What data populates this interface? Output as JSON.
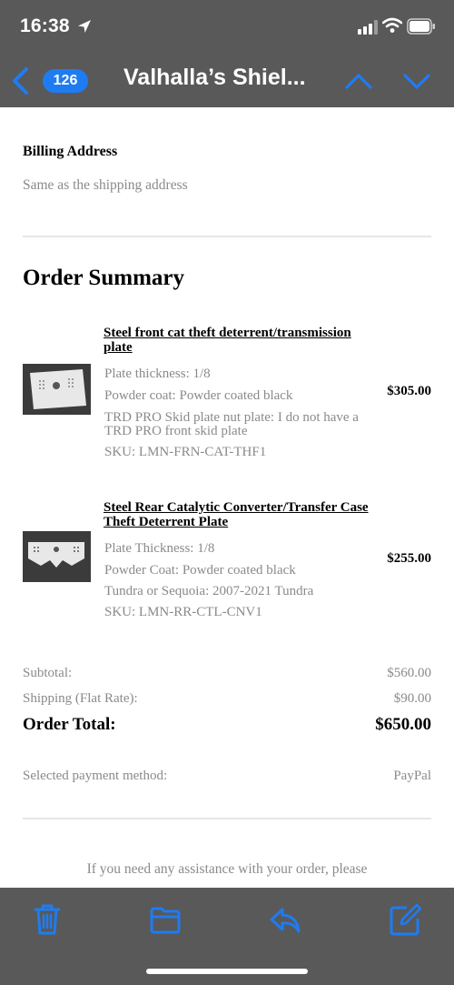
{
  "status_bar": {
    "time": "16:38",
    "icons": [
      "location-arrow-icon",
      "signal-bars-icon",
      "wifi-icon",
      "battery-icon"
    ]
  },
  "nav": {
    "back_icon": "chevron-left-icon",
    "unread_count": "126",
    "title": "Valhalla’s Shiel...",
    "prev_icon": "chevron-up-icon",
    "next_icon": "chevron-down-icon",
    "accent_color": "#1e7cf2"
  },
  "email": {
    "billing": {
      "title": "Billing Address",
      "value": "Same as the shipping address"
    },
    "order_summary_title": "Order Summary",
    "products": [
      {
        "name": "Steel front cat theft deterrent/transmission plate",
        "attributes": [
          "Plate thickness: 1/8",
          "Powder coat: Powder coated black",
          "TRD PRO Skid plate nut plate: I do not have a TRD PRO front skid plate",
          "SKU: LMN-FRN-CAT-THF1"
        ],
        "price": "$305.00"
      },
      {
        "name": "Steel Rear Catalytic Converter/Transfer Case Theft Deterrent Plate",
        "attributes": [
          "Plate Thickness: 1/8",
          "Powder Coat: Powder coated black",
          "Tundra or Sequoia: 2007-2021 Tundra",
          "SKU: LMN-RR-CTL-CNV1"
        ],
        "price": "$255.00"
      }
    ],
    "totals": {
      "subtotal_label": "Subtotal:",
      "subtotal_value": "$560.00",
      "shipping_label": "Shipping (Flat Rate):",
      "shipping_value": "$90.00",
      "total_label": "Order Total:",
      "total_value": "$650.00"
    },
    "payment": {
      "label": "Selected payment method:",
      "value": "PayPal"
    },
    "footer_note": "If you need any assistance with your order, please"
  },
  "toolbar": {
    "icons": [
      "trash-icon",
      "folder-icon",
      "reply-icon",
      "compose-icon"
    ],
    "icon_color": "#1e7cf2"
  }
}
